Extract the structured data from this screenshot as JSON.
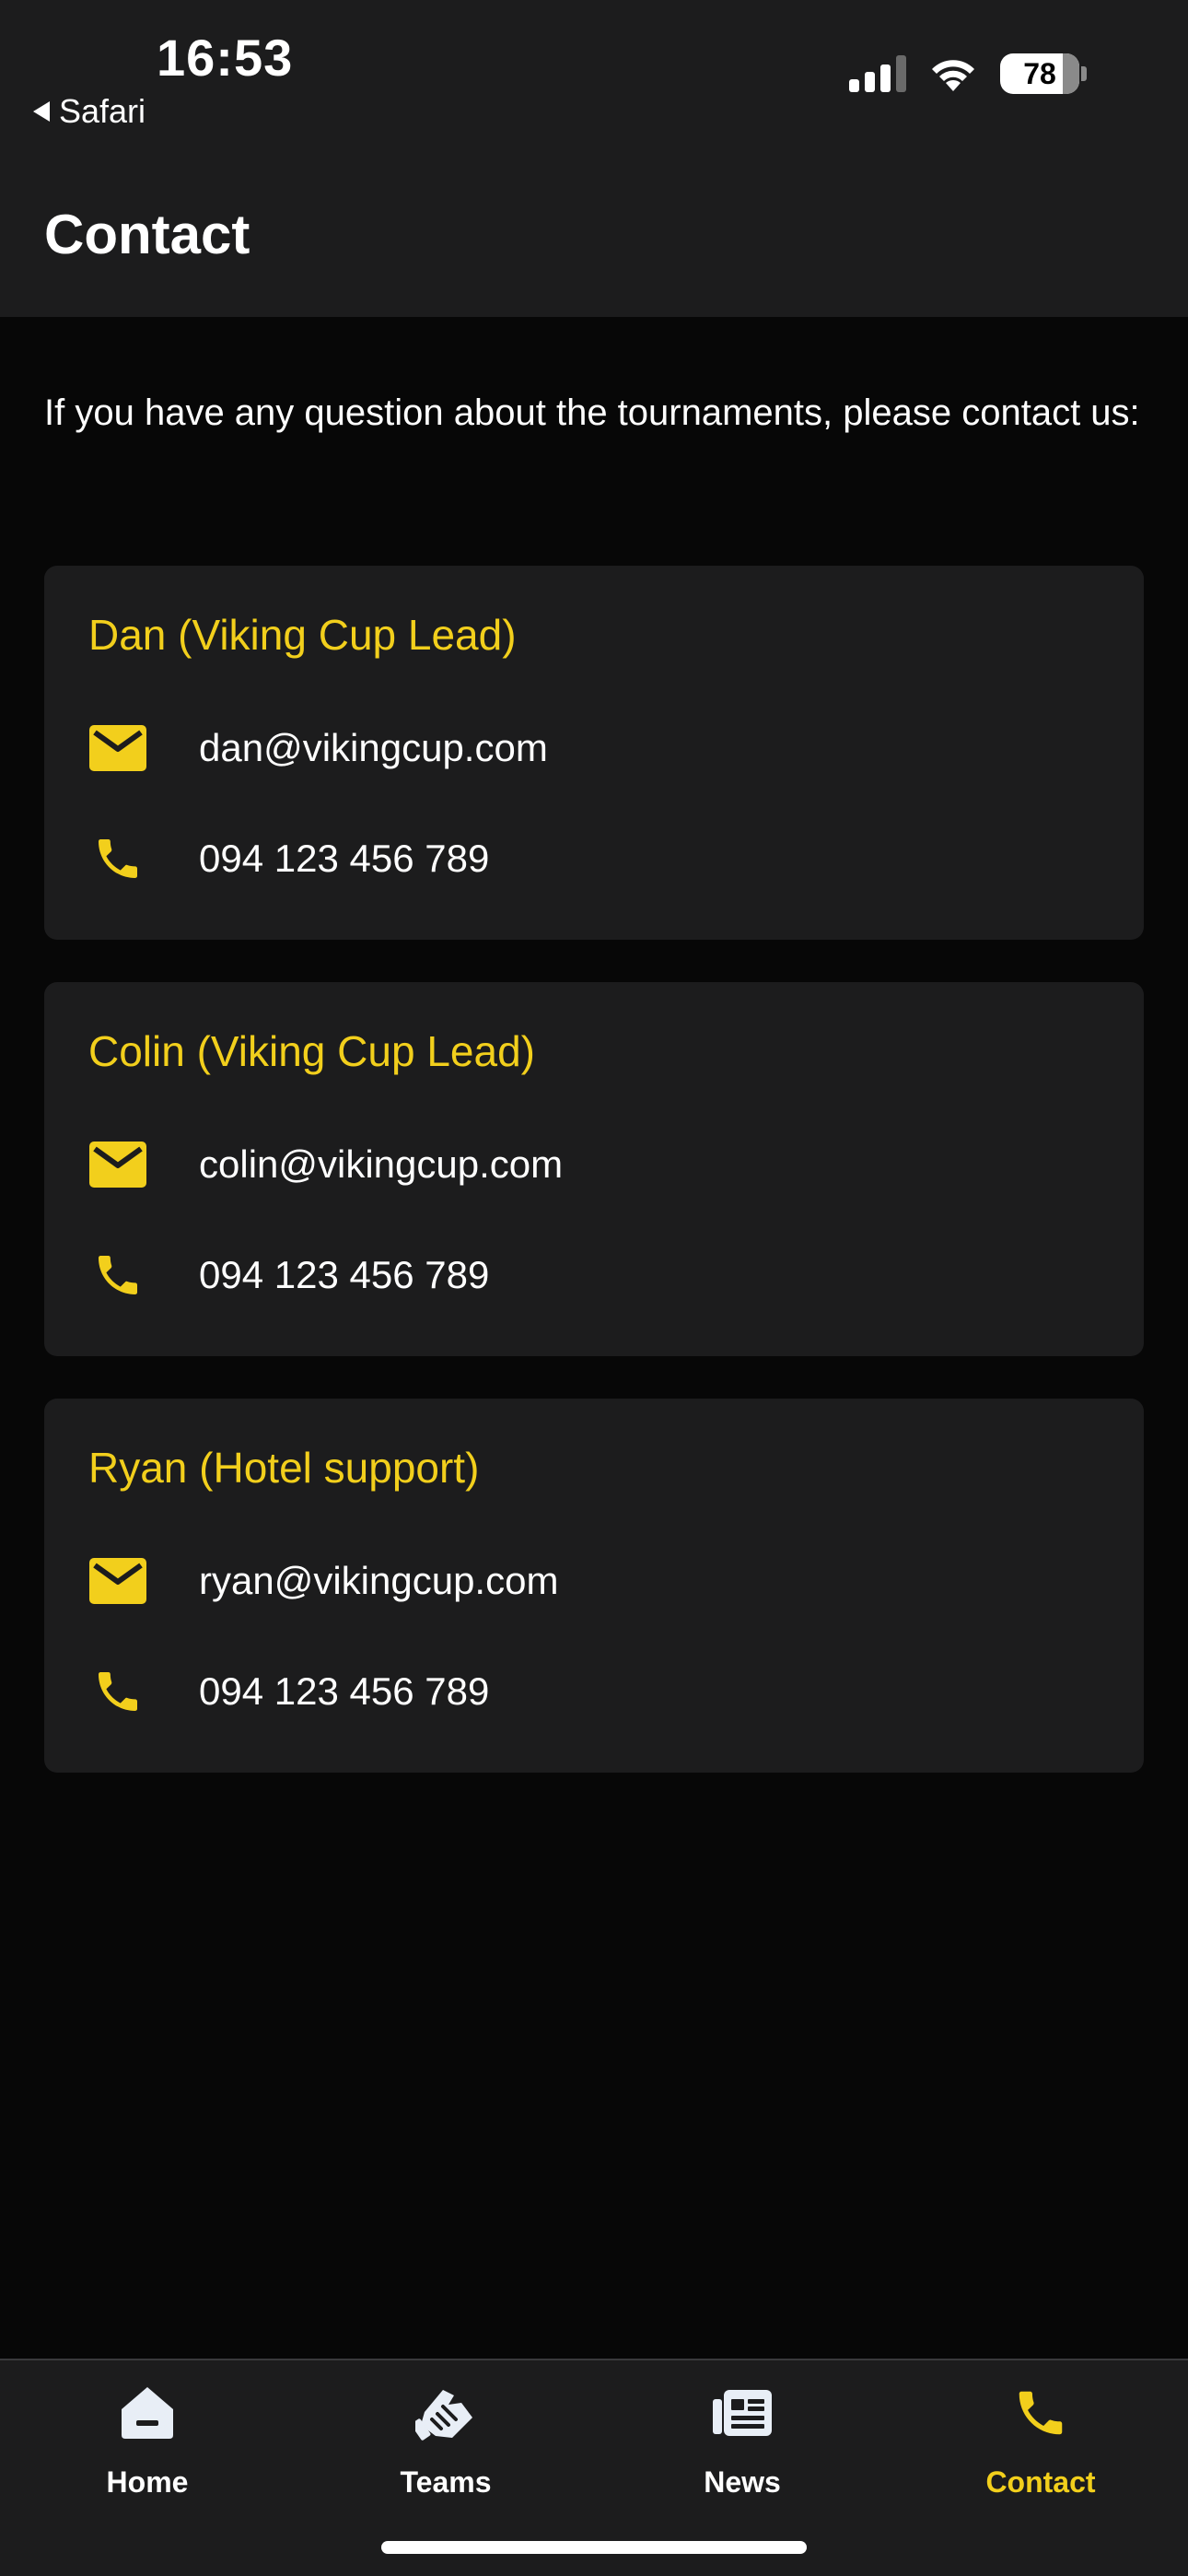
{
  "status_bar": {
    "time": "16:53",
    "back_label": "Safari",
    "battery": "78"
  },
  "header": {
    "title": "Contact"
  },
  "intro": "If you have any question about the tournaments, please contact us:",
  "contacts": [
    {
      "name": "Dan (Viking Cup Lead)",
      "email": "dan@vikingcup.com",
      "phone": "094 123 456 789"
    },
    {
      "name": "Colin (Viking Cup Lead)",
      "email": "colin@vikingcup.com",
      "phone": "094 123 456 789"
    },
    {
      "name": "Ryan (Hotel support)",
      "email": "ryan@vikingcup.com",
      "phone": "094 123 456 789"
    }
  ],
  "tabs": [
    {
      "label": "Home",
      "icon": "home-icon"
    },
    {
      "label": "Teams",
      "icon": "handshake-icon"
    },
    {
      "label": "News",
      "icon": "newspaper-icon"
    },
    {
      "label": "Contact",
      "icon": "phone-icon",
      "active": true
    }
  ],
  "colors": {
    "accent": "#f2cf1c",
    "background": "#070707",
    "surface": "#1c1c1d"
  }
}
